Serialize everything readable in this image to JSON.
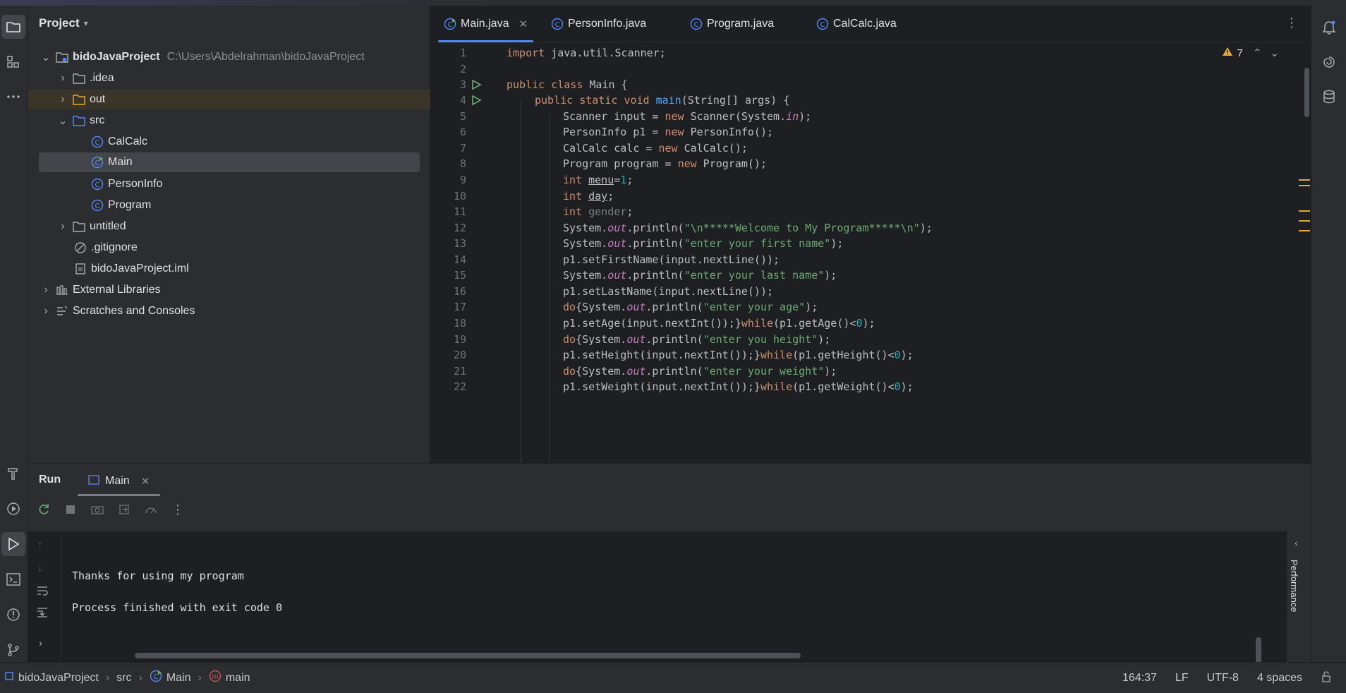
{
  "project_panel": {
    "title": "Project",
    "tree": [
      {
        "label": "bidoJavaProject",
        "path": "C:\\Users\\Abdelrahman\\bidoJavaProject"
      },
      {
        "label": ".idea"
      },
      {
        "label": "out"
      },
      {
        "label": "src"
      },
      {
        "label": "CalCalc"
      },
      {
        "label": "Main"
      },
      {
        "label": "PersonInfo"
      },
      {
        "label": "Program"
      },
      {
        "label": "untitled"
      },
      {
        "label": ".gitignore"
      },
      {
        "label": "bidoJavaProject.iml"
      },
      {
        "label": "External Libraries"
      },
      {
        "label": "Scratches and Consoles"
      }
    ]
  },
  "editor": {
    "tabs": [
      "Main.java",
      "PersonInfo.java",
      "Program.java",
      "CalCalc.java"
    ],
    "active_tab": "Main.java",
    "warnings_count": "7",
    "line_numbers": [
      "1",
      "2",
      "3",
      "4",
      "5",
      "6",
      "7",
      "8",
      "9",
      "10",
      "11",
      "12",
      "13",
      "14",
      "15",
      "16",
      "17",
      "18",
      "19",
      "20",
      "21",
      "22"
    ],
    "code": {
      "l1_kw": "import",
      "l1_rest": " java.util.Scanner;",
      "l3_kw": "public class",
      "l3_rest": " Main {",
      "l4_kw": "public static void",
      "l4_fn": "main",
      "l4_rest": "(String[] args) {",
      "l5_a": "Scanner input = ",
      "l5_kw": "new",
      "l5_b": " Scanner(System.",
      "l5_it": "in",
      "l5_c": ");",
      "l6_a": "PersonInfo p1 = ",
      "l6_kw": "new",
      "l6_b": " PersonInfo();",
      "l7_a": "CalCalc calc = ",
      "l7_kw": "new",
      "l7_b": " CalCalc();",
      "l8_a": "Program program = ",
      "l8_kw": "new",
      "l8_b": " Program();",
      "l9_kw": "int",
      "l9_var": "menu",
      "l9_eq": "=",
      "l9_num": "1",
      "l9_end": ";",
      "l10_kw": "int",
      "l10_var": "day",
      "l10_end": ";",
      "l11_kw": "int",
      "l11_var": "gender",
      "l11_end": ";",
      "sys": "System.",
      "out": "out",
      "println": ".println(",
      "l12_str": "\"\\n*****Welcome to My Program*****\\n\"",
      "l13_str": "\"enter your first name\"",
      "close": ");",
      "l14": "p1.setFirstName(input.nextLine());",
      "l15_str": "\"enter your last name\"",
      "l16": "p1.setLastName(input.nextLine());",
      "do": "do",
      "brace": "{",
      "l17_str": "\"enter your age\"",
      "l18_a": "p1.setAge(input.nextInt());}",
      "while": "while",
      "l18_b": "(p1.getAge()<",
      "zero": "0",
      "l18_c": ");",
      "l19_str": "\"enter you height\"",
      "l20_a": "p1.setHeight(input.nextInt());}",
      "l20_b": "(p1.getHeight()<",
      "l21_str": "\"enter your weight\"",
      "l22_a": "p1.setWeight(input.nextInt());}",
      "l22_b": "(p1.getWeight()<"
    }
  },
  "run_panel": {
    "title": "Run",
    "tab": "Main",
    "console_lines": [
      "Thanks for using my program",
      "Process finished with exit code 0"
    ],
    "side_label": "Performance"
  },
  "status_bar": {
    "crumbs": [
      "bidoJavaProject",
      "src",
      "Main",
      "main"
    ],
    "position": "164:37",
    "line_sep": "LF",
    "encoding": "UTF-8",
    "indent": "4 spaces"
  },
  "colors": {
    "accent": "#548af7",
    "warning": "#e0a93a",
    "keyword": "#cf8e6d",
    "string": "#6aab73",
    "function": "#56a8f5"
  }
}
